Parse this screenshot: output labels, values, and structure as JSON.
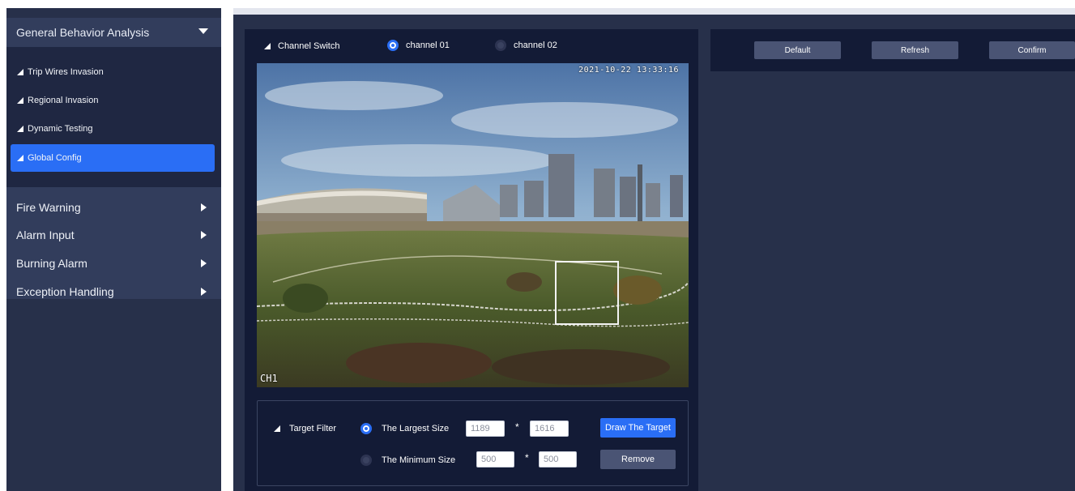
{
  "sidebar": {
    "group_title": "General Behavior Analysis",
    "sub_items": [
      {
        "label": "Trip Wires Invasion"
      },
      {
        "label": "Regional Invasion"
      },
      {
        "label": "Dynamic Testing"
      },
      {
        "label": "Global Config"
      }
    ],
    "other_items": [
      {
        "label": "Fire Warning"
      },
      {
        "label": "Alarm Input"
      },
      {
        "label": "Burning Alarm"
      },
      {
        "label": "Exception Handling"
      }
    ]
  },
  "channel_switch": {
    "label": "Channel Switch",
    "options": [
      {
        "label": "channel 01",
        "selected": true
      },
      {
        "label": "channel 02",
        "selected": false
      }
    ]
  },
  "video": {
    "timestamp": "2021-10-22 13:33:16",
    "channel_overlay": "CH1"
  },
  "target_filter": {
    "label": "Target Filter",
    "largest": {
      "label": "The Largest Size",
      "width": "1189",
      "height": "1616",
      "selected": true
    },
    "minimum": {
      "label": "The Minimum Size",
      "width": "500",
      "height": "500",
      "selected": false
    },
    "separator": "*",
    "draw_button": "Draw The Target",
    "remove_button": "Remove"
  },
  "actions": {
    "default": "Default",
    "refresh": "Refresh",
    "confirm": "Confirm"
  },
  "colors": {
    "accent": "#2a6ef5",
    "sidebar_bg": "#27304a",
    "panel_bg": "#131b36"
  }
}
